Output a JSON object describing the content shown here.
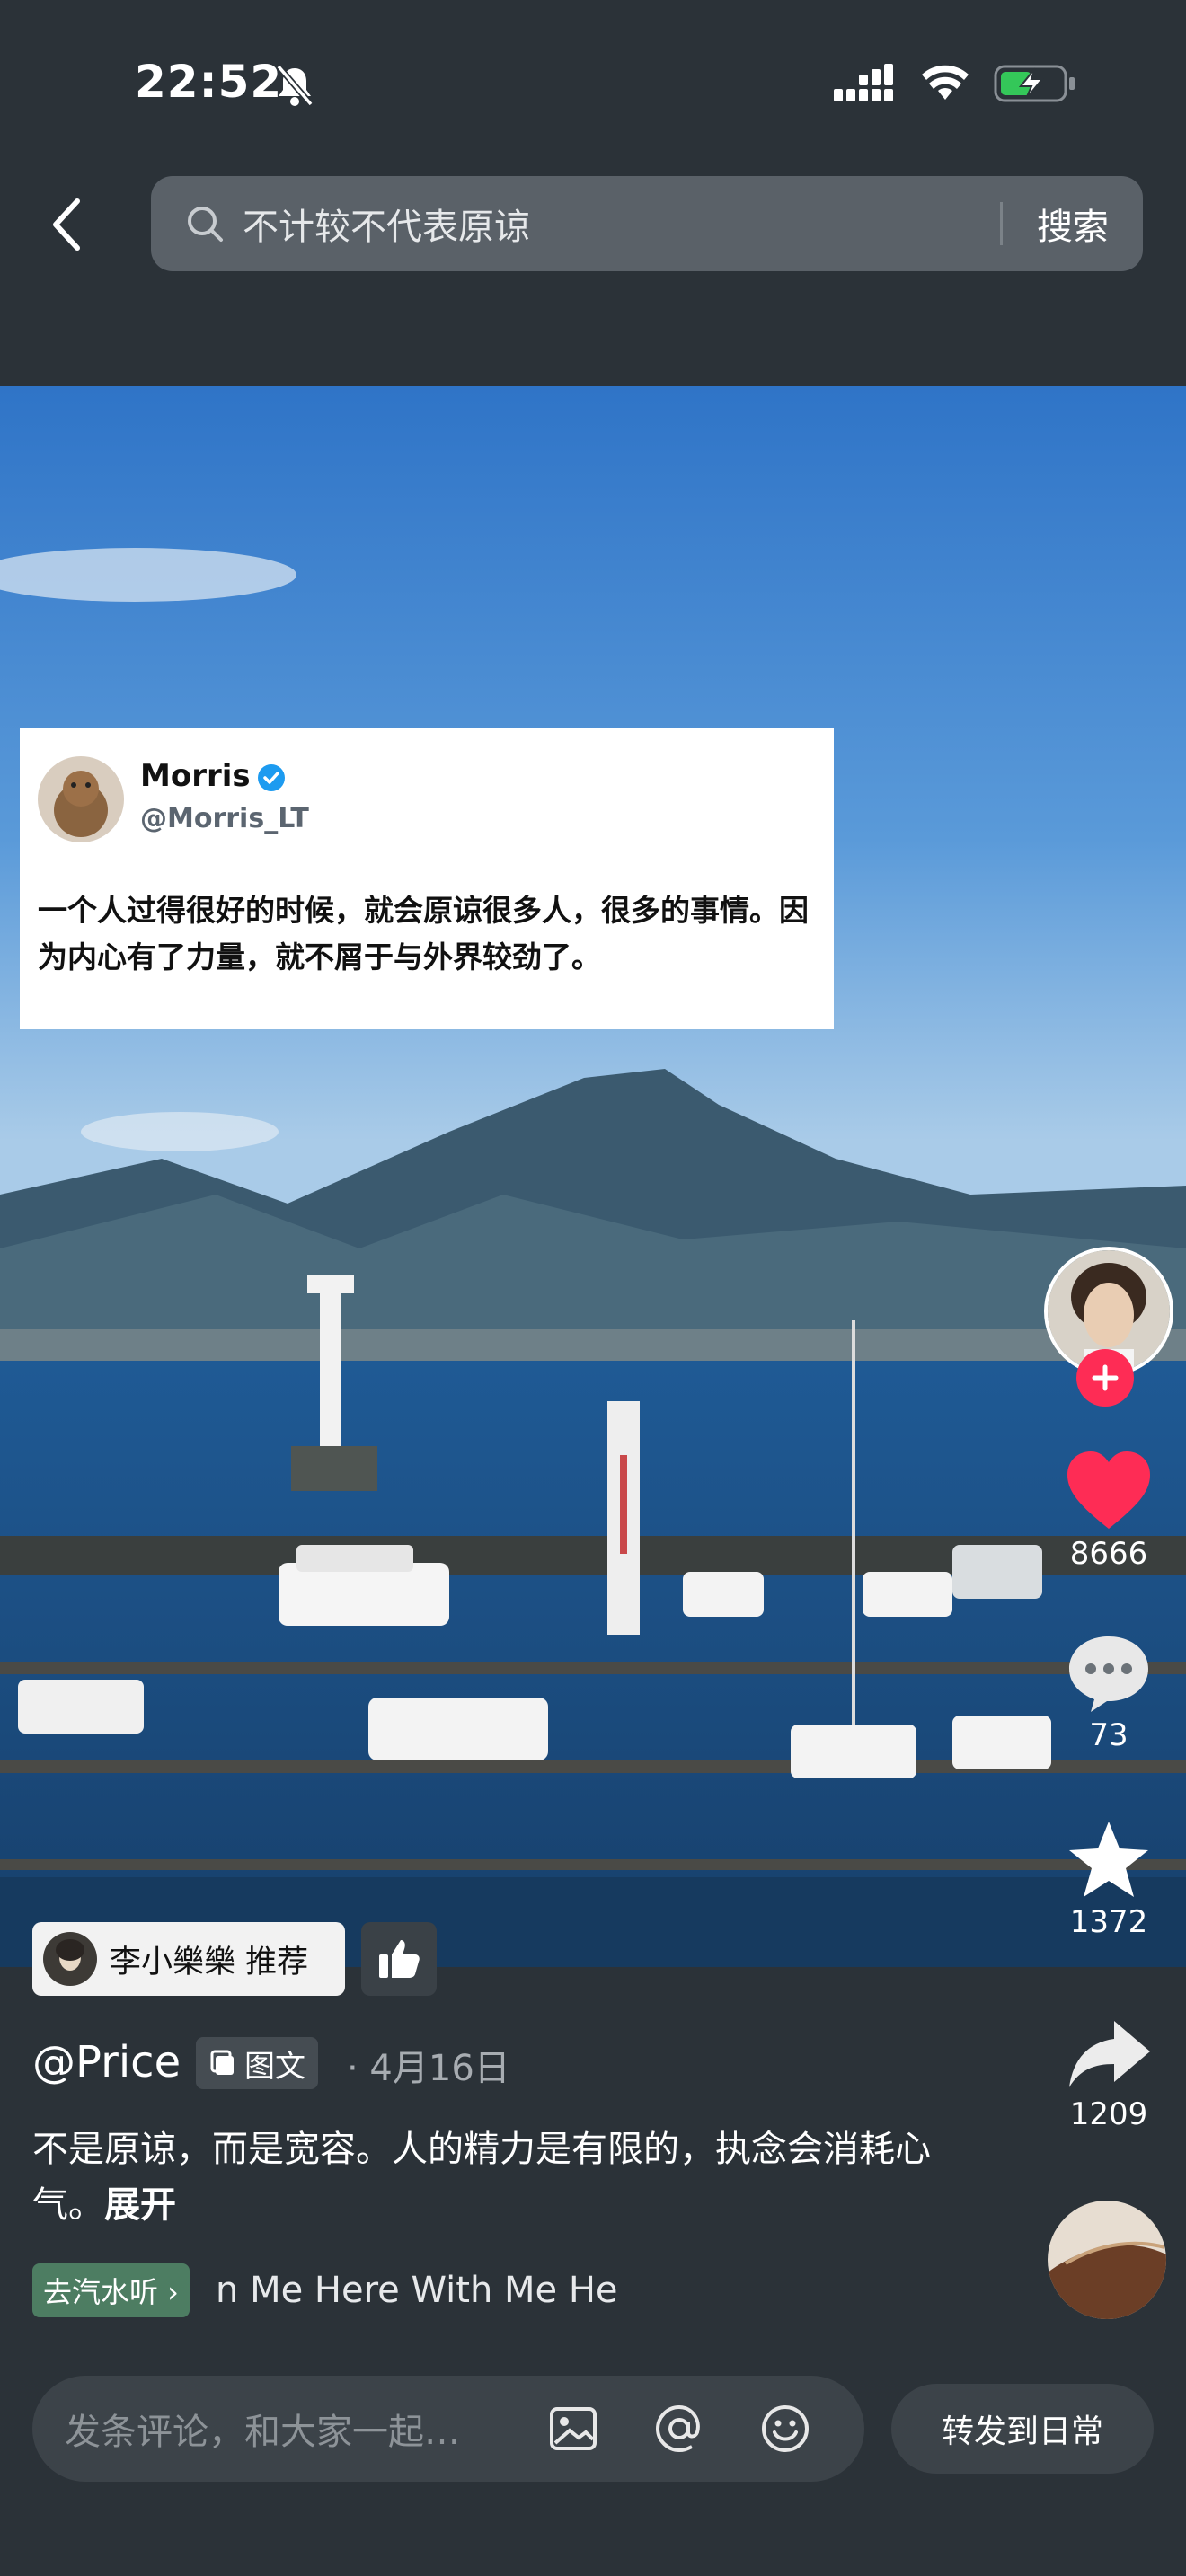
{
  "status_bar": {
    "time": "22:52"
  },
  "search": {
    "query": "不计较不代表原谅",
    "button": "搜索"
  },
  "tweet": {
    "name": "Morris",
    "handle": "@Morris_LT",
    "text": "一个人过得很好的时候，就会原谅很多人，很多的事情。因为内心有了力量，就不屑于与外界较劲了。"
  },
  "actions": {
    "likes": "8666",
    "comments": "73",
    "favorites": "1372",
    "shares": "1209"
  },
  "recommend": {
    "text": "李小樂樂 推荐"
  },
  "post": {
    "author": "@Price",
    "type_label": "图文",
    "date": "· 4月16日",
    "caption": "不是原谅，而是宽容。人的精力是有限的，执念会消耗心气。",
    "expand": "展开"
  },
  "music": {
    "chip": "去汽水听 ›",
    "scroll_text": "n Me   Here With Me   He"
  },
  "bottom": {
    "comment_placeholder": "发条评论，和大家一起…",
    "forward_button": "转发到日常"
  },
  "colors": {
    "like_red": "#fe2c55",
    "background": "#2b3238",
    "music_green": "#4d7d62"
  }
}
